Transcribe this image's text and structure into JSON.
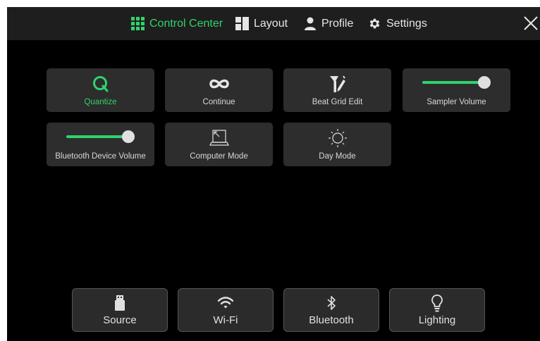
{
  "topbar": {
    "tabs": [
      {
        "label": "Control Center",
        "icon": "grid-icon",
        "active": true
      },
      {
        "label": "Layout",
        "icon": "layout-icon",
        "active": false
      },
      {
        "label": "Profile",
        "icon": "person-icon",
        "active": false
      },
      {
        "label": "Settings",
        "icon": "gear-icon",
        "active": false
      }
    ],
    "close_icon": "close-icon"
  },
  "tiles": [
    {
      "label": "Quantize",
      "icon": "quantize-icon",
      "active": true
    },
    {
      "label": "Continue",
      "icon": "infinity-icon",
      "active": false
    },
    {
      "label": "Beat Grid Edit",
      "icon": "beat-grid-edit-icon",
      "active": false
    },
    {
      "label": "Sampler Volume",
      "type": "slider",
      "level": 1.0
    },
    {
      "label": "Bluetooth Device Volume",
      "type": "slider",
      "level": 1.0
    },
    {
      "label": "Computer Mode",
      "icon": "laptop-icon",
      "active": false
    },
    {
      "label": "Day Mode",
      "icon": "sun-icon",
      "active": false
    }
  ],
  "bottom": [
    {
      "label": "Source",
      "icon": "usb-icon"
    },
    {
      "label": "Wi-Fi",
      "icon": "wifi-icon"
    },
    {
      "label": "Bluetooth",
      "icon": "bluetooth-icon"
    },
    {
      "label": "Lighting",
      "icon": "lightbulb-icon"
    }
  ],
  "colors": {
    "accent": "#2fd46a",
    "tile_bg": "#2d2d2d",
    "topbar_bg": "#1e1e1e",
    "background": "#000000"
  }
}
